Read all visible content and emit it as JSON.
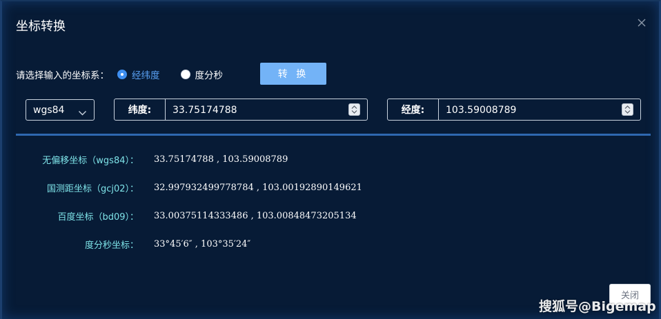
{
  "dialog": {
    "title": "坐标转换"
  },
  "input": {
    "prompt": "请选择输入的坐标系：",
    "radio_options": [
      {
        "label": "经纬度",
        "checked": true
      },
      {
        "label": "度分秒",
        "checked": false
      }
    ],
    "convert_label": "转 换",
    "datum_select": {
      "selected": "wgs84"
    },
    "latitude": {
      "label": "纬度:",
      "value": "33.75174788"
    },
    "longitude": {
      "label": "经度:",
      "value": "103.59008789"
    }
  },
  "results": [
    {
      "label": "无偏移坐标（wgs84）：",
      "value": "33.75174788 , 103.59008789"
    },
    {
      "label": "国测距坐标（gcj02）：",
      "value": "32.997932499778784 , 103.00192890149621"
    },
    {
      "label": "百度坐标（bd09）：",
      "value": "33.00375114333486 , 103.00848473205134"
    },
    {
      "label": "度分秒坐标：",
      "value": "33°45′6″ , 103°35′24″"
    }
  ],
  "footer": {
    "close_label": "关闭"
  },
  "watermark": "搜狐号@Bigemap",
  "colors": {
    "background": "#071b36",
    "accent": "#3f8ff0",
    "button": "#73b3f7",
    "result_label": "#7ee3e8",
    "divider": "#2f68b0"
  },
  "icons": {
    "close": "close-icon",
    "dropdown": "chevron-down-icon",
    "spinner": "spinner-icon"
  }
}
